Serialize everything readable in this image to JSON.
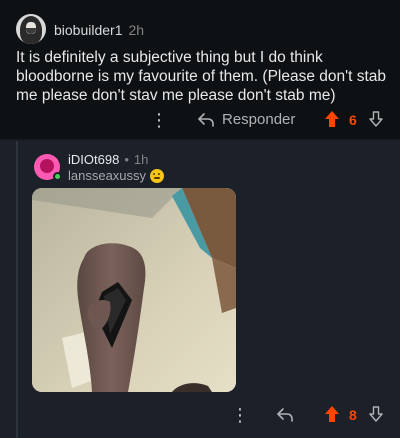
{
  "top_comment": {
    "username": "biobuilder1",
    "time": "2h",
    "body": "It is definitely a subjective thing but I do think bloodborne is my favourite of them. (Please don't stab me please don't stav me please don't stab me)",
    "actions": {
      "reply_label": "Responder",
      "score": "6",
      "more_icon": "more-vertical-icon",
      "reply_icon": "reply-arrow-icon",
      "upvote_icon": "upvote-arrow-icon",
      "downvote_icon": "downvote-arrow-icon"
    }
  },
  "reply_comment": {
    "username": "iDIOt698",
    "time": "1h",
    "separator": "•",
    "flair": "lansseaxussy",
    "flair_icon": "smiling-emoji-icon",
    "online": true,
    "image_alt": "photo of hand holding knife",
    "actions": {
      "score": "8",
      "more_icon": "more-vertical-icon",
      "reply_icon": "reply-arrow-icon",
      "upvote_icon": "upvote-arrow-icon",
      "downvote_icon": "downvote-arrow-icon"
    }
  },
  "colors": {
    "background": "#0e1113",
    "reply_background": "#1c2129",
    "upvote_orange": "#ff4500",
    "online_green": "#46d160"
  }
}
